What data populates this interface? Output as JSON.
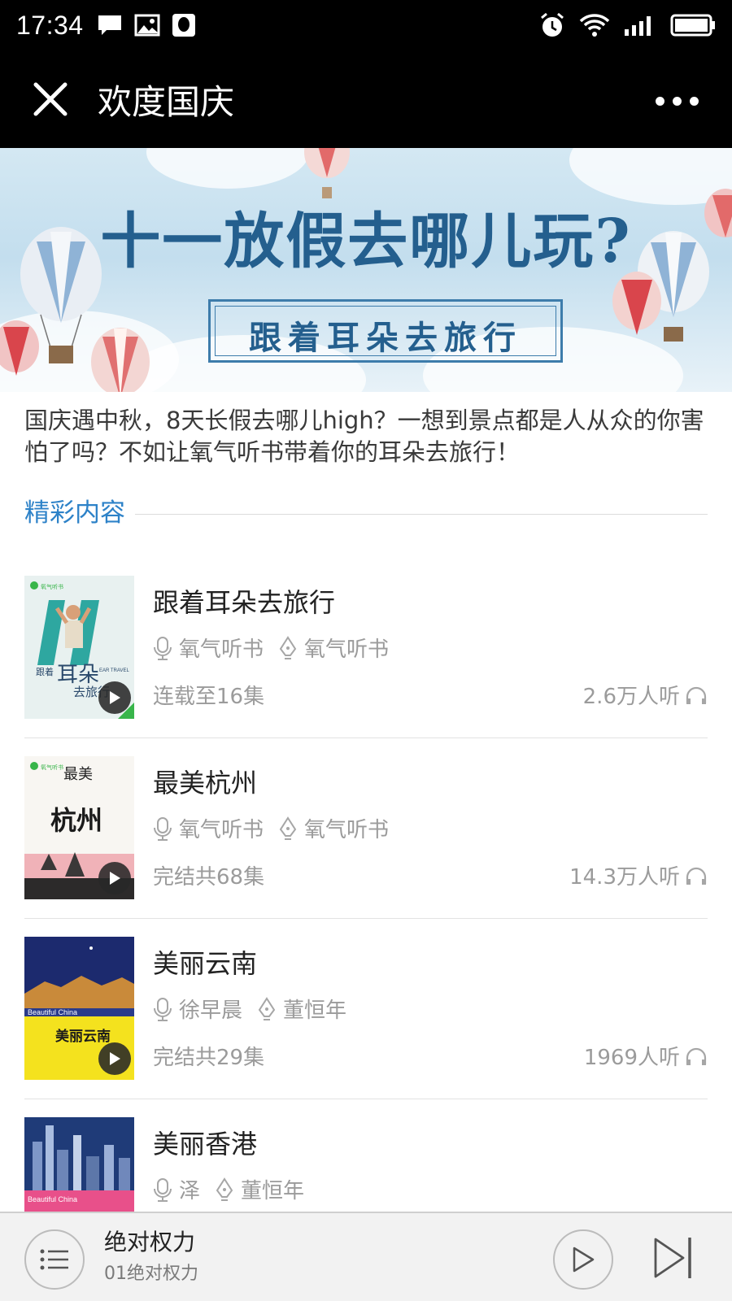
{
  "status_bar": {
    "time": "17:34"
  },
  "nav": {
    "title": "欢度国庆"
  },
  "banner": {
    "headline": "十一放假去哪儿玩?",
    "subtitle": "跟着耳朵去旅行"
  },
  "intro_text": "国庆遇中秋，8天长假去哪儿high？一想到景点都是人从众的你害怕了吗？不如让氧气听书带着你的耳朵去旅行！",
  "section_title": "精彩内容",
  "items": [
    {
      "title": "跟着耳朵去旅行",
      "narrator": "氧气听书",
      "author": "氧气听书",
      "episodes": "连载至16集",
      "listens": "2.6万人听"
    },
    {
      "title": "最美杭州",
      "narrator": "氧气听书",
      "author": "氧气听书",
      "episodes": "完结共68集",
      "listens": "14.3万人听"
    },
    {
      "title": "美丽云南",
      "narrator": "徐早晨",
      "author": "董恒年",
      "episodes": "完结共29集",
      "listens": "1969人听"
    },
    {
      "title": "美丽香港",
      "narrator": "泽",
      "author": "董恒年",
      "episodes": "",
      "listens": ""
    }
  ],
  "covers": [
    {
      "label_main": "耳朵",
      "label_a": "跟着",
      "label_b": "去旅行",
      "label_c": "EAR TRAVEL"
    },
    {
      "label_main": "杭州",
      "label_a": "最美"
    },
    {
      "label_main": "美丽云南",
      "label_a": "Beautiful China"
    },
    {
      "label_a": "Beautiful China"
    }
  ],
  "player": {
    "title": "绝对权力",
    "subtitle": "01绝对权力"
  },
  "colors": {
    "accent": "#2d82c8",
    "bar": "#000000",
    "meta": "#9b9b9b"
  }
}
